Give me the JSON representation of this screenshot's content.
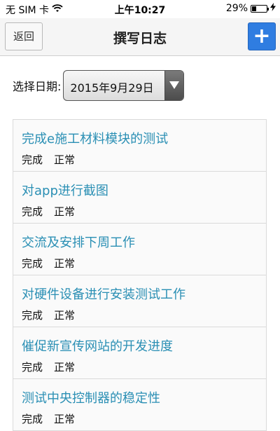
{
  "status_bar": {
    "carrier": "无 SIM 卡",
    "wifi_icon": "wifi-icon",
    "time": "上午10:27",
    "battery_percent_text": "29%",
    "battery_level": 0.29,
    "charging_icon": "bolt-icon"
  },
  "nav": {
    "back_label": "返回",
    "title": "撰写日志",
    "add_icon": "plus-icon",
    "add_label": "+",
    "accent_color": "#2f7de1"
  },
  "date_picker": {
    "label": "选择日期:",
    "selected_value": "2015年9月29日",
    "arrow_icon": "chevron-down-icon"
  },
  "logs": [
    {
      "title": "完成e施工材料模块的测试",
      "status": "完成",
      "priority": "正常"
    },
    {
      "title": "对app进行截图",
      "status": "完成",
      "priority": "正常"
    },
    {
      "title": "交流及安排下周工作",
      "status": "完成",
      "priority": "正常"
    },
    {
      "title": "对硬件设备进行安装测试工作",
      "status": "完成",
      "priority": "正常"
    },
    {
      "title": "催促新宣传网站的开发进度",
      "status": "完成",
      "priority": "正常"
    },
    {
      "title": "测试中央控制器的稳定性",
      "status": "完成",
      "priority": "正常"
    }
  ],
  "colors": {
    "link_title": "#2a8fb4"
  }
}
